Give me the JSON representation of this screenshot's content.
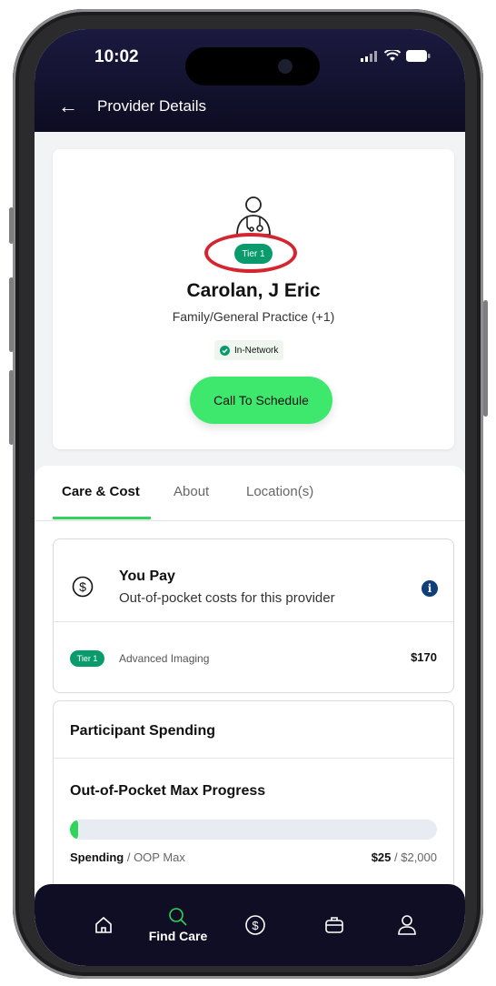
{
  "status_bar": {
    "time": "10:02"
  },
  "header": {
    "title": "Provider Details"
  },
  "provider": {
    "tier": "Tier 1",
    "name": "Carolan, J Eric",
    "specialty": "Family/General Practice (+1)",
    "network": "In-Network",
    "call_button": "Call To Schedule"
  },
  "tabs": [
    {
      "label": "Care & Cost",
      "active": true
    },
    {
      "label": "About"
    },
    {
      "label": "Location(s)"
    }
  ],
  "you_pay": {
    "title": "You Pay",
    "subtitle": "Out-of-pocket costs for this provider",
    "info_icon": "i",
    "item": {
      "tier": "Tier 1",
      "service": "Advanced Imaging",
      "price": "$170"
    }
  },
  "spending": {
    "title": "Participant Spending",
    "oop_title": "Out-of-Pocket Max Progress",
    "progress_fraction": 0.0125,
    "legend_spending": "Spending",
    "legend_separator": " / ",
    "legend_max": "OOP Max",
    "spent": "$25",
    "max": "$2,000"
  },
  "nav": {
    "items": [
      {
        "icon": "home-icon"
      },
      {
        "icon": "search-icon",
        "label": "Find Care",
        "active": true
      },
      {
        "icon": "dollar-icon"
      },
      {
        "icon": "briefcase-icon"
      },
      {
        "icon": "profile-icon"
      }
    ]
  },
  "colors": {
    "accent": "#2fd45b",
    "tier": "#0a9b6c",
    "header": "#13122e",
    "highlight": "#d32630"
  }
}
